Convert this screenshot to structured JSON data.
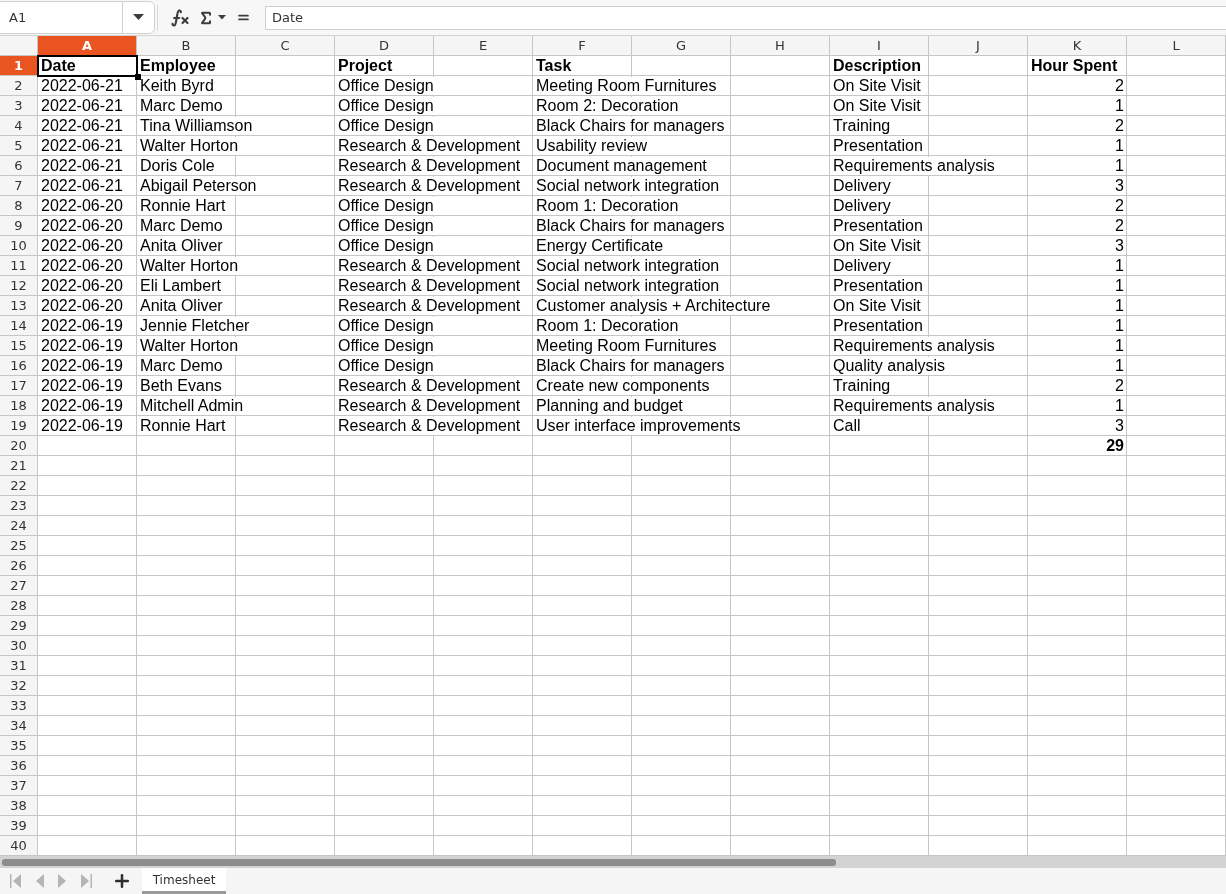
{
  "name_box": {
    "value": "A1"
  },
  "formula_bar": {
    "value": "Date"
  },
  "columns": [
    {
      "label": "A",
      "selected": true
    },
    {
      "label": "B",
      "selected": false
    },
    {
      "label": "C",
      "selected": false
    },
    {
      "label": "D",
      "selected": false
    },
    {
      "label": "E",
      "selected": false
    },
    {
      "label": "F",
      "selected": false
    },
    {
      "label": "G",
      "selected": false
    },
    {
      "label": "H",
      "selected": false
    },
    {
      "label": "I",
      "selected": false
    },
    {
      "label": "J",
      "selected": false
    },
    {
      "label": "K",
      "selected": false
    },
    {
      "label": "L",
      "selected": false
    }
  ],
  "rows": [
    {
      "number": "1",
      "selected": true,
      "kind": "header",
      "date": "Date",
      "employee": "Employee",
      "project": "Project",
      "task": "Task",
      "description": "Description",
      "hours": "Hour Spent"
    },
    {
      "number": "2",
      "selected": false,
      "kind": "entry",
      "date": "2022-06-21",
      "employee": "Keith Byrd",
      "project": "Office Design",
      "task": "Meeting Room Furnitures",
      "description": "On Site Visit",
      "hours": "2"
    },
    {
      "number": "3",
      "selected": false,
      "kind": "entry",
      "date": "2022-06-21",
      "employee": "Marc Demo",
      "project": "Office Design",
      "task": "Room 2: Decoration",
      "description": "On Site Visit",
      "hours": "1"
    },
    {
      "number": "4",
      "selected": false,
      "kind": "entry",
      "date": "2022-06-21",
      "employee": "Tina Williamson",
      "project": "Office Design",
      "task": "Black Chairs for managers",
      "description": "Training",
      "hours": "2"
    },
    {
      "number": "5",
      "selected": false,
      "kind": "entry",
      "date": "2022-06-21",
      "employee": "Walter Horton",
      "project": "Research & Development",
      "task": "Usability review",
      "description": "Presentation",
      "hours": "1"
    },
    {
      "number": "6",
      "selected": false,
      "kind": "entry",
      "date": "2022-06-21",
      "employee": "Doris Cole",
      "project": "Research & Development",
      "task": "Document management",
      "description": "Requirements analysis",
      "hours": "1"
    },
    {
      "number": "7",
      "selected": false,
      "kind": "entry",
      "date": "2022-06-21",
      "employee": "Abigail Peterson",
      "project": "Research & Development",
      "task": "Social network integration",
      "description": "Delivery",
      "hours": "3"
    },
    {
      "number": "8",
      "selected": false,
      "kind": "entry",
      "date": "2022-06-20",
      "employee": "Ronnie Hart",
      "project": "Office Design",
      "task": "Room 1: Decoration",
      "description": "Delivery",
      "hours": "2"
    },
    {
      "number": "9",
      "selected": false,
      "kind": "entry",
      "date": "2022-06-20",
      "employee": "Marc Demo",
      "project": "Office Design",
      "task": "Black Chairs for managers",
      "description": "Presentation",
      "hours": "2"
    },
    {
      "number": "10",
      "selected": false,
      "kind": "entry",
      "date": "2022-06-20",
      "employee": "Anita Oliver",
      "project": "Office Design",
      "task": "Energy Certificate",
      "description": "On Site Visit",
      "hours": "3"
    },
    {
      "number": "11",
      "selected": false,
      "kind": "entry",
      "date": "2022-06-20",
      "employee": "Walter Horton",
      "project": "Research & Development",
      "task": "Social network integration",
      "description": "Delivery",
      "hours": "1"
    },
    {
      "number": "12",
      "selected": false,
      "kind": "entry",
      "date": "2022-06-20",
      "employee": "Eli Lambert",
      "project": "Research & Development",
      "task": "Social network integration",
      "description": "Presentation",
      "hours": "1"
    },
    {
      "number": "13",
      "selected": false,
      "kind": "entry",
      "date": "2022-06-20",
      "employee": "Anita Oliver",
      "project": "Research & Development",
      "task": "Customer analysis + Architecture",
      "description": "On Site Visit",
      "hours": "1"
    },
    {
      "number": "14",
      "selected": false,
      "kind": "entry",
      "date": "2022-06-19",
      "employee": "Jennie Fletcher",
      "project": "Office Design",
      "task": "Room 1: Decoration",
      "description": "Presentation",
      "hours": "1"
    },
    {
      "number": "15",
      "selected": false,
      "kind": "entry",
      "date": "2022-06-19",
      "employee": "Walter Horton",
      "project": "Office Design",
      "task": "Meeting Room Furnitures",
      "description": "Requirements analysis",
      "hours": "1"
    },
    {
      "number": "16",
      "selected": false,
      "kind": "entry",
      "date": "2022-06-19",
      "employee": "Marc Demo",
      "project": "Office Design",
      "task": "Black Chairs for managers",
      "description": "Quality analysis",
      "hours": "1"
    },
    {
      "number": "17",
      "selected": false,
      "kind": "entry",
      "date": "2022-06-19",
      "employee": "Beth Evans",
      "project": "Research & Development",
      "task": "Create new components",
      "description": "Training",
      "hours": "2"
    },
    {
      "number": "18",
      "selected": false,
      "kind": "entry",
      "date": "2022-06-19",
      "employee": "Mitchell Admin",
      "project": "Research & Development",
      "task": "Planning and budget",
      "description": "Requirements analysis",
      "hours": "1"
    },
    {
      "number": "19",
      "selected": false,
      "kind": "entry",
      "date": "2022-06-19",
      "employee": "Ronnie Hart",
      "project": "Research & Development",
      "task": "User interface improvements",
      "description": "Call",
      "hours": "3"
    },
    {
      "number": "20",
      "selected": false,
      "kind": "total",
      "hours": "29"
    },
    {
      "number": "21",
      "selected": false,
      "kind": "empty"
    },
    {
      "number": "22",
      "selected": false,
      "kind": "empty"
    },
    {
      "number": "23",
      "selected": false,
      "kind": "empty"
    },
    {
      "number": "24",
      "selected": false,
      "kind": "empty"
    },
    {
      "number": "25",
      "selected": false,
      "kind": "empty"
    },
    {
      "number": "26",
      "selected": false,
      "kind": "empty"
    },
    {
      "number": "27",
      "selected": false,
      "kind": "empty"
    },
    {
      "number": "28",
      "selected": false,
      "kind": "empty"
    },
    {
      "number": "29",
      "selected": false,
      "kind": "empty"
    },
    {
      "number": "30",
      "selected": false,
      "kind": "empty"
    },
    {
      "number": "31",
      "selected": false,
      "kind": "empty"
    },
    {
      "number": "32",
      "selected": false,
      "kind": "empty"
    },
    {
      "number": "33",
      "selected": false,
      "kind": "empty"
    },
    {
      "number": "34",
      "selected": false,
      "kind": "empty"
    },
    {
      "number": "35",
      "selected": false,
      "kind": "empty"
    },
    {
      "number": "36",
      "selected": false,
      "kind": "empty"
    },
    {
      "number": "37",
      "selected": false,
      "kind": "empty"
    },
    {
      "number": "38",
      "selected": false,
      "kind": "empty"
    },
    {
      "number": "39",
      "selected": false,
      "kind": "empty"
    },
    {
      "number": "40",
      "selected": false,
      "kind": "empty"
    }
  ],
  "sheet_tabs": [
    {
      "label": "Timesheet",
      "selected": true
    }
  ]
}
